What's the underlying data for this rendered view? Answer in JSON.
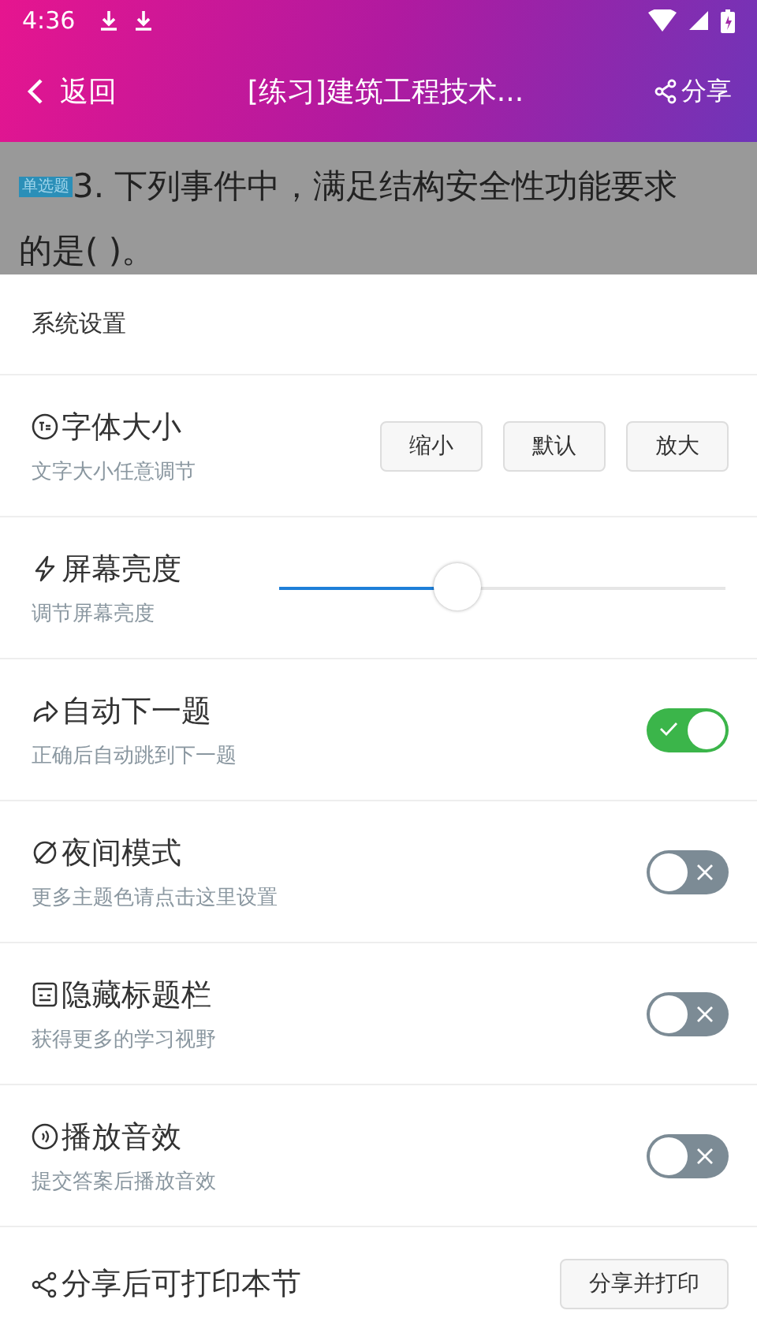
{
  "status_bar": {
    "time": "4:36"
  },
  "app_bar": {
    "back_label": "返回",
    "title": "[练习]建筑工程技术...",
    "share_label": "分享"
  },
  "question": {
    "type_tag": "单选题",
    "text": "3. 下列事件中，满足结构安全性功能要求的是( )。"
  },
  "settings": {
    "title": "系统设置",
    "rows": [
      {
        "kind": "buttons",
        "label": "字体大小",
        "hint": "文字大小任意调节",
        "buttons": [
          "缩小",
          "默认",
          "放大"
        ]
      },
      {
        "kind": "slider",
        "label": "屏幕亮度",
        "hint": "调节屏幕亮度",
        "level": 0.4
      },
      {
        "kind": "toggle",
        "label": "自动下一题",
        "hint": "正确后自动跳到下一题",
        "on": true
      },
      {
        "kind": "toggle",
        "label": "夜间模式",
        "hint": "更多主题色请点击这里设置",
        "on": false
      },
      {
        "kind": "toggle",
        "label": "隐藏标题栏",
        "hint": "获得更多的学习视野",
        "on": false
      },
      {
        "kind": "toggle",
        "label": "播放音效",
        "hint": "提交答案后播放音效",
        "on": false
      },
      {
        "kind": "action",
        "label": "分享后可打印本节",
        "button": "分享并打印"
      }
    ]
  }
}
